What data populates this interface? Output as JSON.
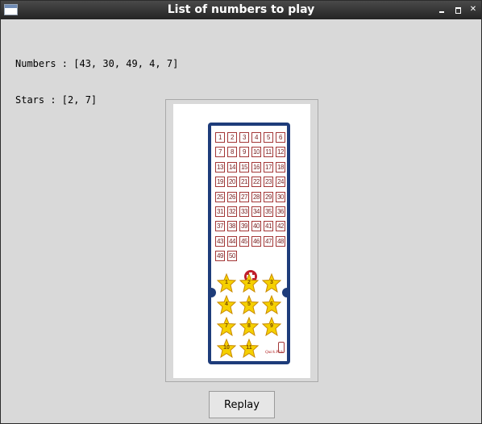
{
  "window": {
    "title": "List of numbers to play"
  },
  "info": {
    "numbers_line": "Numbers : [43, 30, 49, 4, 7]",
    "stars_line": "Stars : [2, 7]"
  },
  "ticket": {
    "numbers": [
      "1",
      "2",
      "3",
      "4",
      "5",
      "6",
      "7",
      "8",
      "9",
      "10",
      "11",
      "12",
      "13",
      "14",
      "15",
      "16",
      "17",
      "18",
      "19",
      "20",
      "21",
      "22",
      "23",
      "24",
      "25",
      "26",
      "27",
      "28",
      "29",
      "30",
      "31",
      "32",
      "33",
      "34",
      "35",
      "36",
      "37",
      "38",
      "39",
      "40",
      "41",
      "42",
      "43",
      "44",
      "45",
      "46",
      "47",
      "48",
      "49",
      "50"
    ],
    "stars": [
      "1",
      "2",
      "3",
      "4",
      "5",
      "6",
      "7",
      "8",
      "9",
      "10",
      "11"
    ],
    "quick_pick_label": "Quick Pick",
    "colors": {
      "ticket_border": "#1e3c7a",
      "number_box": "#a33636",
      "star_fill": "#f5d000",
      "plus": "#c01e2b"
    }
  },
  "actions": {
    "replay_label": "Replay"
  }
}
